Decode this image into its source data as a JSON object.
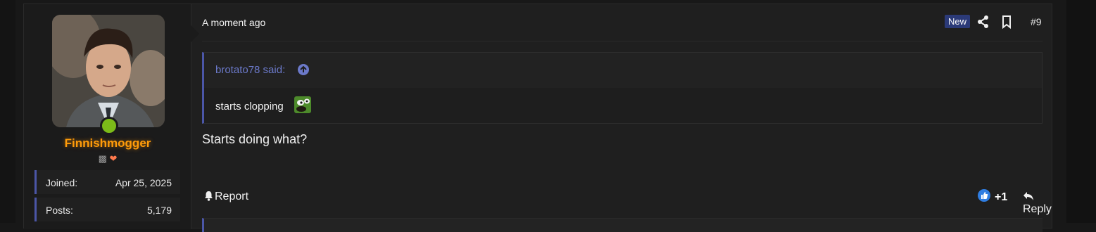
{
  "user": {
    "name": "Finnishmogger",
    "badges": [
      "robot-icon",
      "heart-icon"
    ],
    "stats": [
      {
        "key": "Joined:",
        "value": "Apr 25, 2025"
      },
      {
        "key": "Posts:",
        "value": "5,179"
      }
    ],
    "online": true,
    "name_color": "#ff9c0a"
  },
  "post": {
    "time": "A moment ago",
    "new_label": "New",
    "number": "#9",
    "quote": {
      "author_label": "brotato78 said:",
      "text": "starts clopping",
      "emoji": "pepe-emoji"
    },
    "body": "Starts doing what?",
    "actions": {
      "report_label": "Report",
      "reaction_count": "+1",
      "reply_label": "Reply"
    }
  },
  "colors": {
    "accent": "#4b56a7",
    "quote_link": "#6b79c9",
    "online": "#7cbb19",
    "new_badge": "#2b3a78"
  }
}
